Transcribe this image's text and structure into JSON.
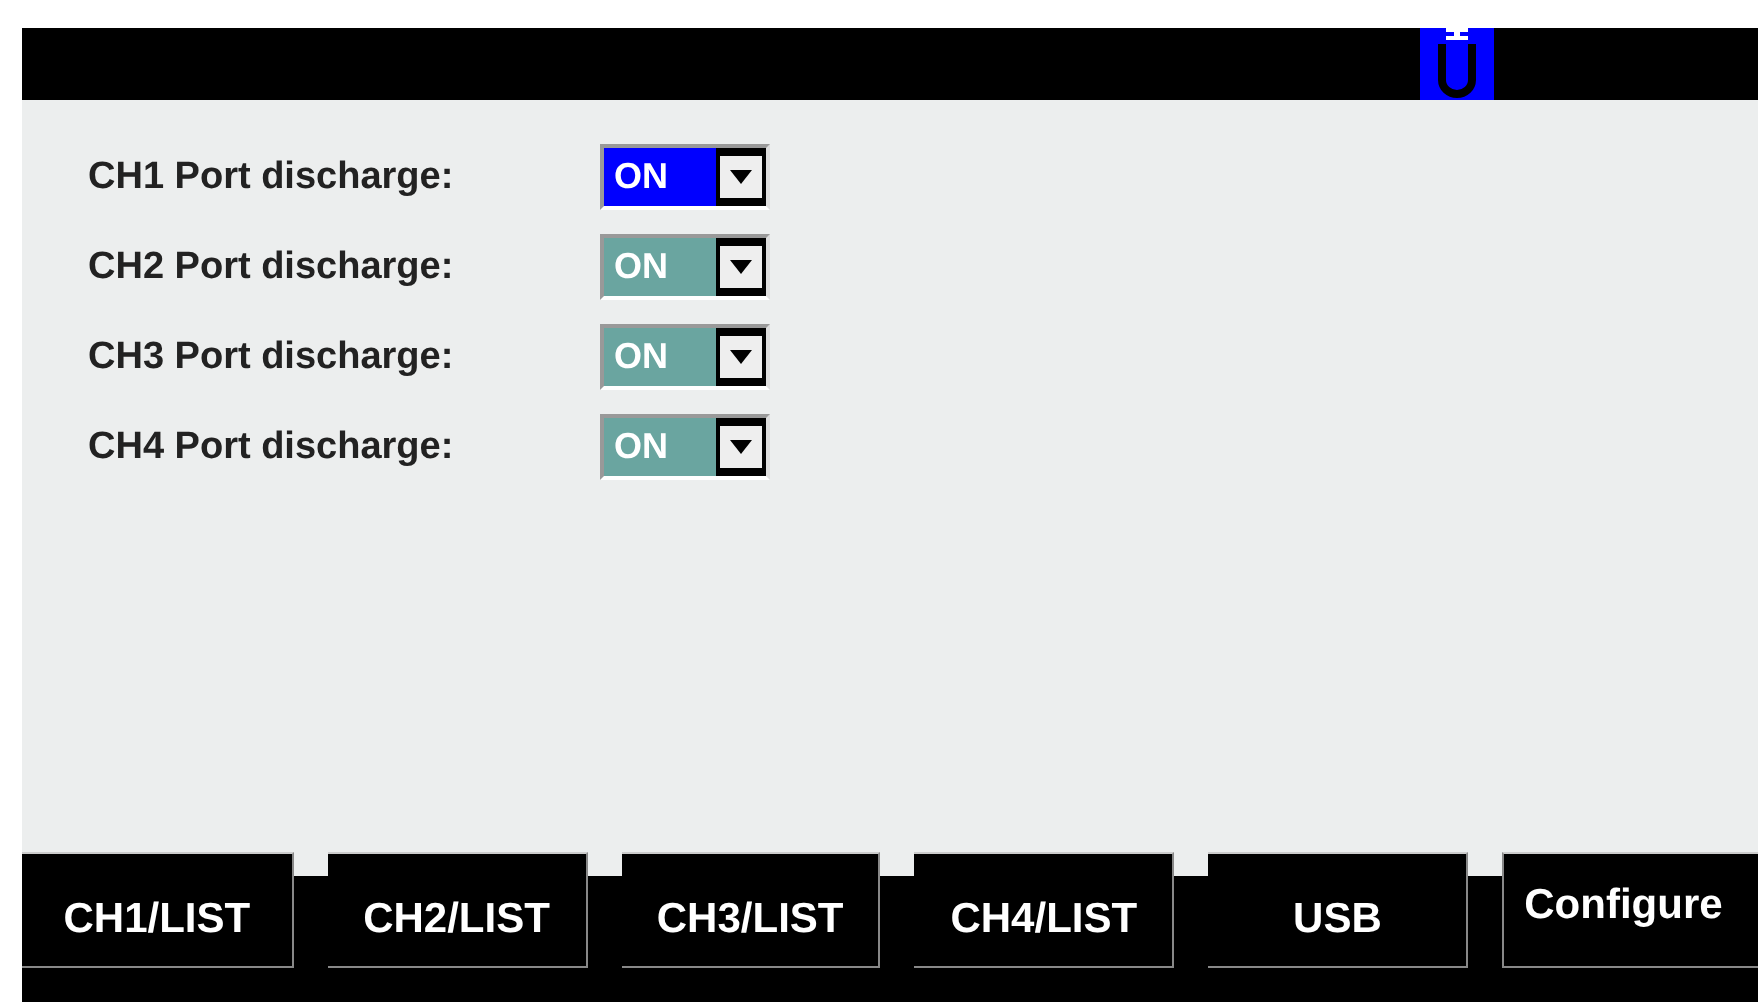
{
  "header": {
    "usb_connected": true
  },
  "settings": [
    {
      "label": "CH1 Port discharge:",
      "value": "ON",
      "selected": true
    },
    {
      "label": "CH2 Port discharge:",
      "value": "ON",
      "selected": false
    },
    {
      "label": "CH3 Port discharge:",
      "value": "ON",
      "selected": false
    },
    {
      "label": "CH4 Port discharge:",
      "value": "ON",
      "selected": false
    }
  ],
  "softkeys": [
    "CH1/LIST",
    "CH2/LIST",
    "CH3/LIST",
    "CH4/LIST",
    "USB",
    "Configure"
  ]
}
